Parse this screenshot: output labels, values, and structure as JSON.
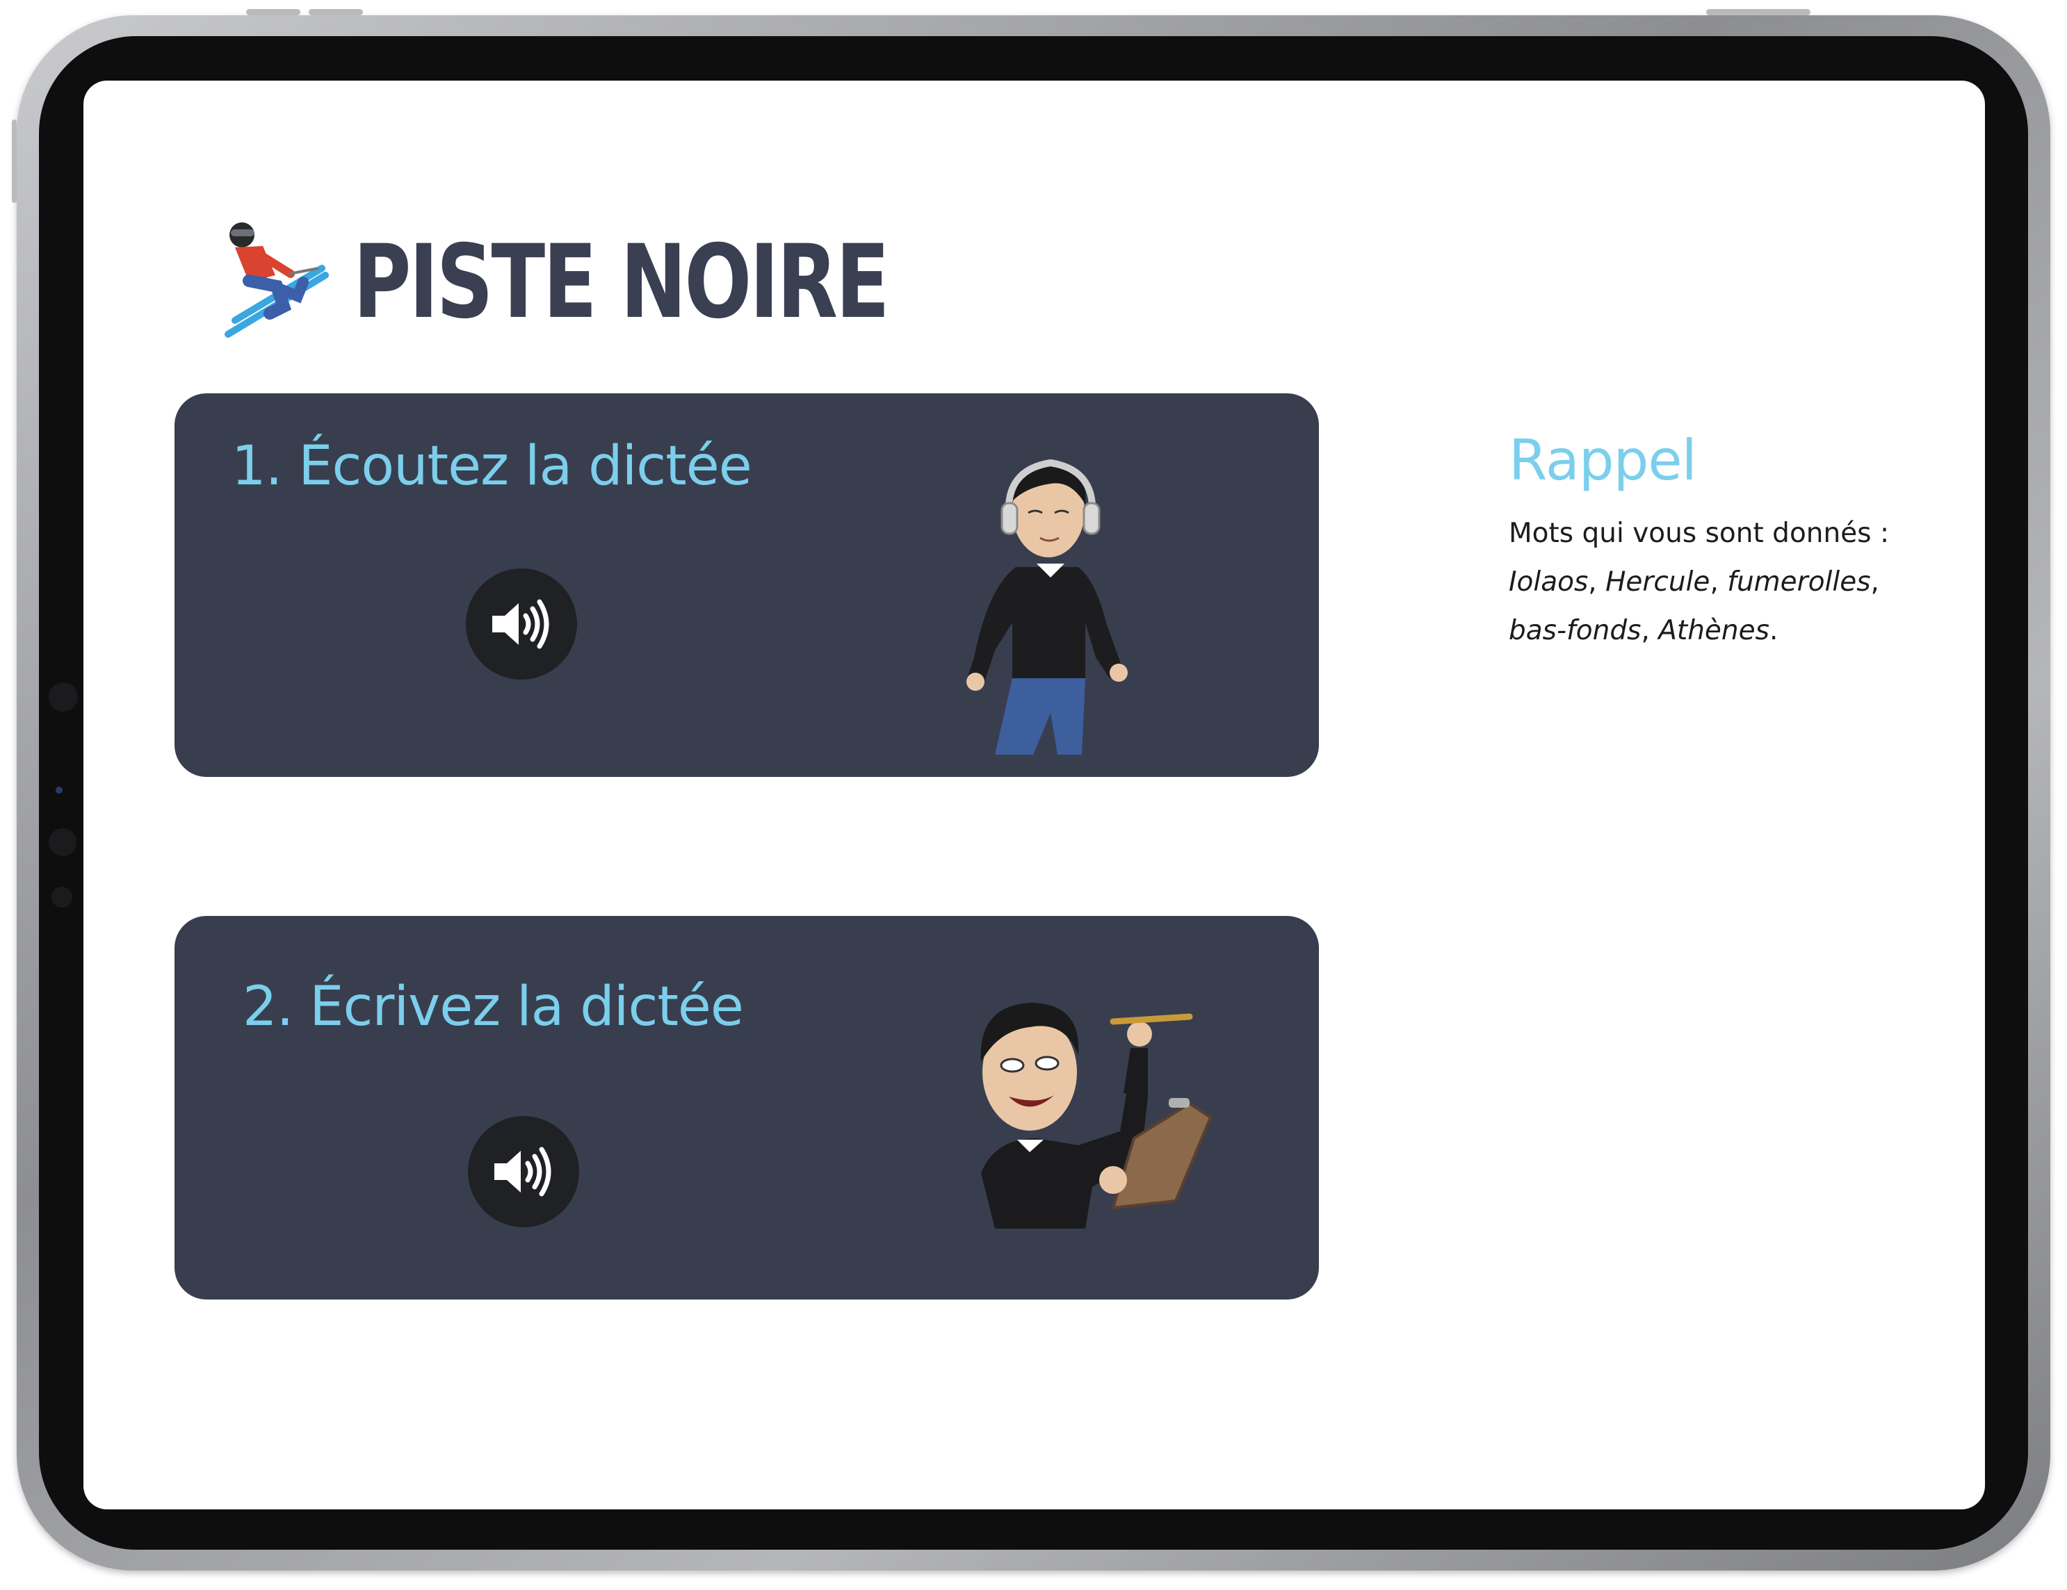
{
  "page": {
    "title": "PISTE NOIRE",
    "title_icon": "skier-icon"
  },
  "cards": [
    {
      "title": "1. Écoutez la dictée",
      "button_icon": "speaker-icon",
      "avatar": "avatar-headphones"
    },
    {
      "title": "2. Écrivez la dictée",
      "button_icon": "speaker-icon",
      "avatar": "avatar-writing-clipboard"
    }
  ],
  "aside": {
    "title": "Rappel",
    "intro": "Mots qui vous sont donnés : ",
    "words": [
      "Iolaos",
      "Hercule",
      "fumerolles",
      "bas-fonds",
      "Athènes"
    ],
    "separator": ", ",
    "end": "."
  },
  "colors": {
    "title": "#3a3f52",
    "card_bg": "#393e4e",
    "accent": "#7bcfec",
    "audio_btn": "#202124"
  }
}
